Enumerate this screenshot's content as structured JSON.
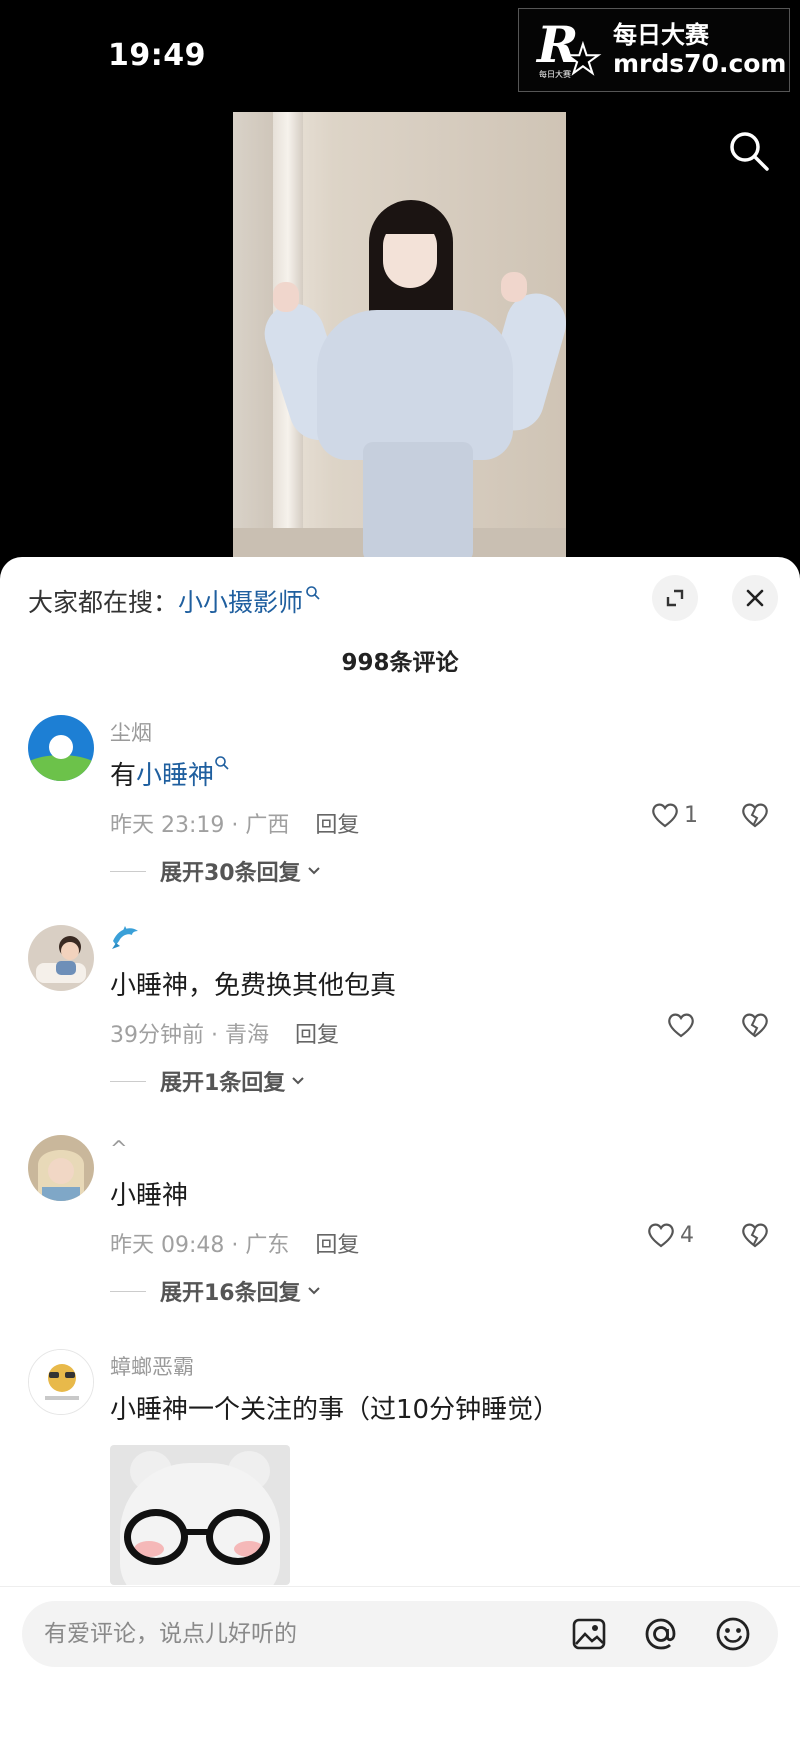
{
  "status": {
    "time": "19:49"
  },
  "watermark": {
    "logo_letter": "R",
    "logo_small": "每日大赛",
    "line1": "每日大赛",
    "line2": "mrds70.com"
  },
  "hot_search": {
    "prefix": "大家都在搜：",
    "keyword": "小小摄影师"
  },
  "comment_count": "998条评论",
  "comments": [
    {
      "user": "尘烟",
      "text_prefix": "有",
      "text_keyword": "小睡神",
      "meta": "昨天 23:19 · 广西",
      "reply": "回复",
      "likes": "1",
      "expand": "展开30条回复"
    },
    {
      "user": "",
      "text": "小睡神，免费换其他包真",
      "meta": "39分钟前 · 青海",
      "reply": "回复",
      "likes": "",
      "expand": "展开1条回复"
    },
    {
      "user": "^",
      "text": "小睡神",
      "meta": "昨天 09:48 · 广东",
      "reply": "回复",
      "likes": "4",
      "expand": "展开16条回复"
    },
    {
      "user": "蟑螂恶霸",
      "text": "小睡神一个关注的事（过10分钟睡觉）"
    }
  ],
  "input": {
    "placeholder": "有爱评论，说点儿好听的"
  },
  "icons": {
    "top_search": "search-icon",
    "expand": "collapse-icon",
    "close": "close-icon",
    "like": "heart-icon",
    "dislike": "broken-heart-icon",
    "image": "image-icon",
    "mention": "at-icon",
    "emoji": "emoji-icon"
  },
  "colors": {
    "keyword": "#1f5f9f",
    "panel_bg": "#ffffff",
    "meta": "#a0a0a0"
  }
}
